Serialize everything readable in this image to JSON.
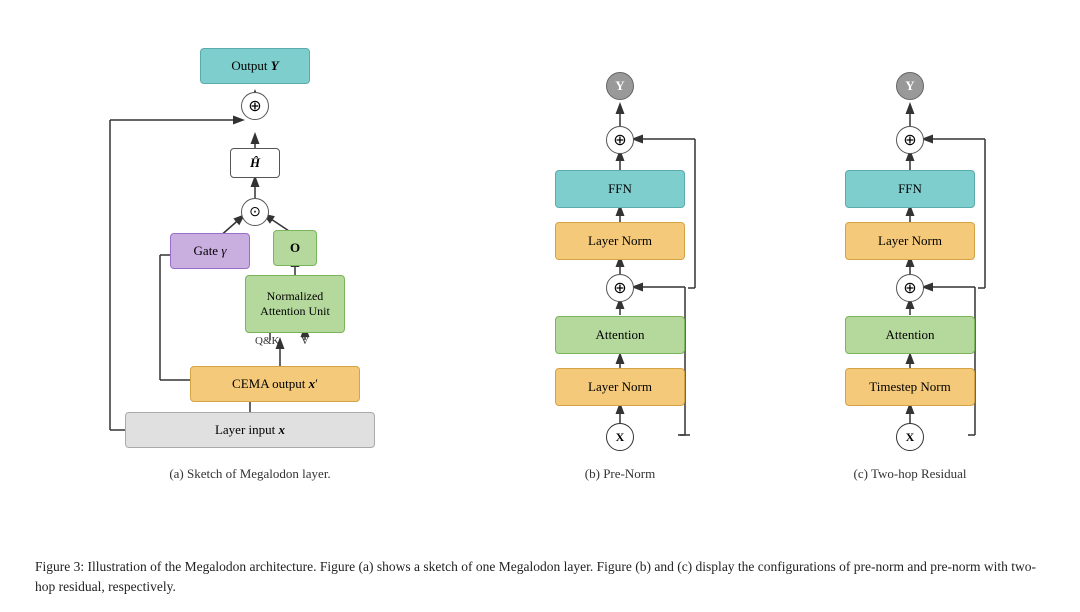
{
  "diagrams": {
    "a": {
      "title": "Sketch of Megalodon layer.",
      "boxes": {
        "output": "Output Y",
        "h_hat": "Ĥ",
        "gate": "Gate γ",
        "o_box": "O",
        "nau": "Normalized\nAttention Unit",
        "cema": "CEMA output x′",
        "input": "Layer input x"
      }
    },
    "b": {
      "title": "(b) Pre-Norm",
      "boxes": {
        "ffn": "FFN",
        "layer_norm_top": "Layer Norm",
        "attention": "Attention",
        "layer_norm_bot": "Layer Norm"
      },
      "x_label": "X",
      "y_label": "Y"
    },
    "c": {
      "title": "(c) Two-hop Residual",
      "boxes": {
        "ffn": "FFN",
        "layer_norm_top": "Layer Norm",
        "attention": "Attention",
        "timestep_norm": "Timestep Norm"
      },
      "x_label": "X",
      "y_label": "Y"
    }
  },
  "figure_caption": "Figure 3: Illustration of the Megalodon architecture. Figure (a) shows a sketch of one Megalodon layer. Figure (b) and (c) display the configurations of pre-norm and pre-norm with two-hop residual, respectively.",
  "colors": {
    "blue": "#7ecece",
    "orange": "#f5c97a",
    "green": "#b5d99c",
    "purple": "#c9aee0",
    "gray": "#e0e0e0"
  }
}
